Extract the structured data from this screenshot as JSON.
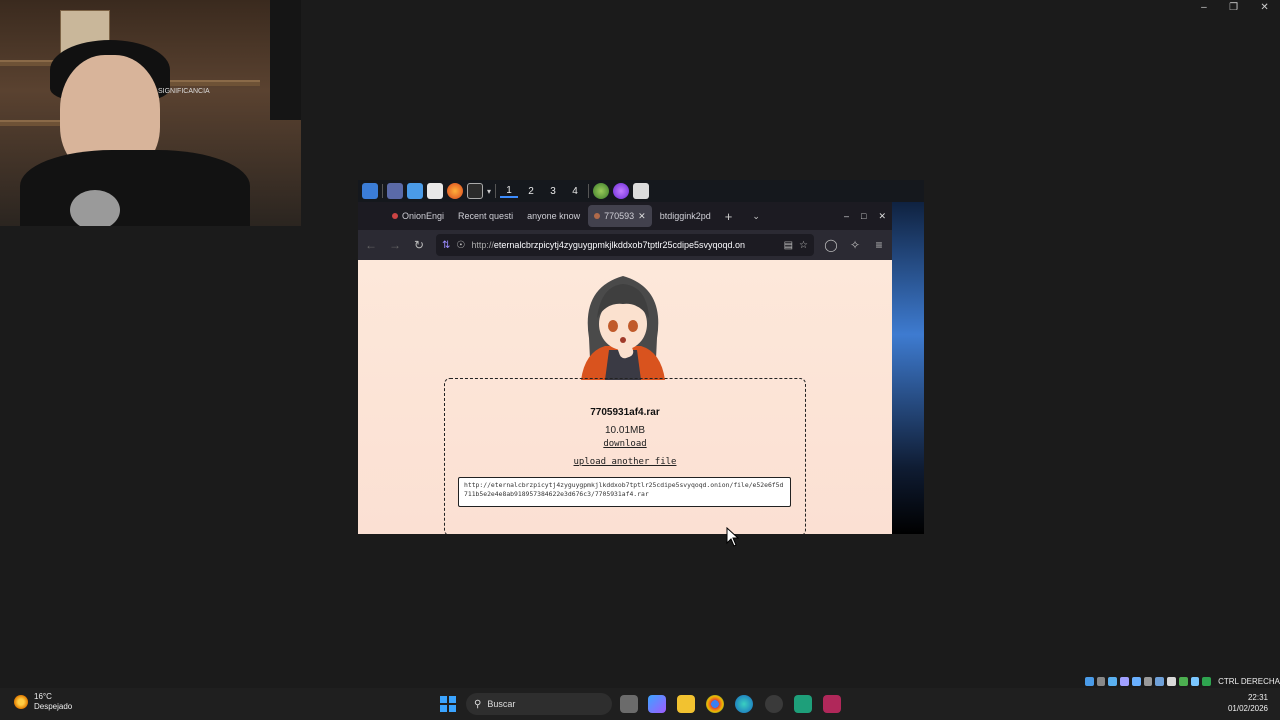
{
  "webcam": {
    "sign_text": "SIGNIFICANCIA"
  },
  "vm_panel": {
    "workspaces": [
      "1",
      "2",
      "3",
      "4"
    ]
  },
  "browser": {
    "tabs": [
      {
        "label": "OnionEngi"
      },
      {
        "label": "Recent questi"
      },
      {
        "label": "anyone know"
      },
      {
        "label": "770593"
      },
      {
        "label": "btdiggink2pd"
      }
    ],
    "url_protocol": "http://",
    "url_host": "eternalcbrzpicytj4zyguygpmkjlkddxob7tptlr25cdipe5svyqoqd.on"
  },
  "page": {
    "file_name": "7705931af4.rar",
    "file_size": "10.01MB",
    "download_label": "download",
    "upload_label": "upload another file",
    "share_link": "http://eternalcbrzpicytj4zyguygpmkjlkddxob7tptlr25cdipe5svyqoqd.onion/file/e52e6f5d711b5e2e4e8ab918957384622e3d676c3/7705931af4.rar"
  },
  "tray": {
    "label": "CTRL DERECHA"
  },
  "taskbar": {
    "weather_temp": "16°C",
    "weather_desc": "Despejado",
    "search_placeholder": "Buscar",
    "time": "22:31",
    "date": "01/02/2026"
  }
}
